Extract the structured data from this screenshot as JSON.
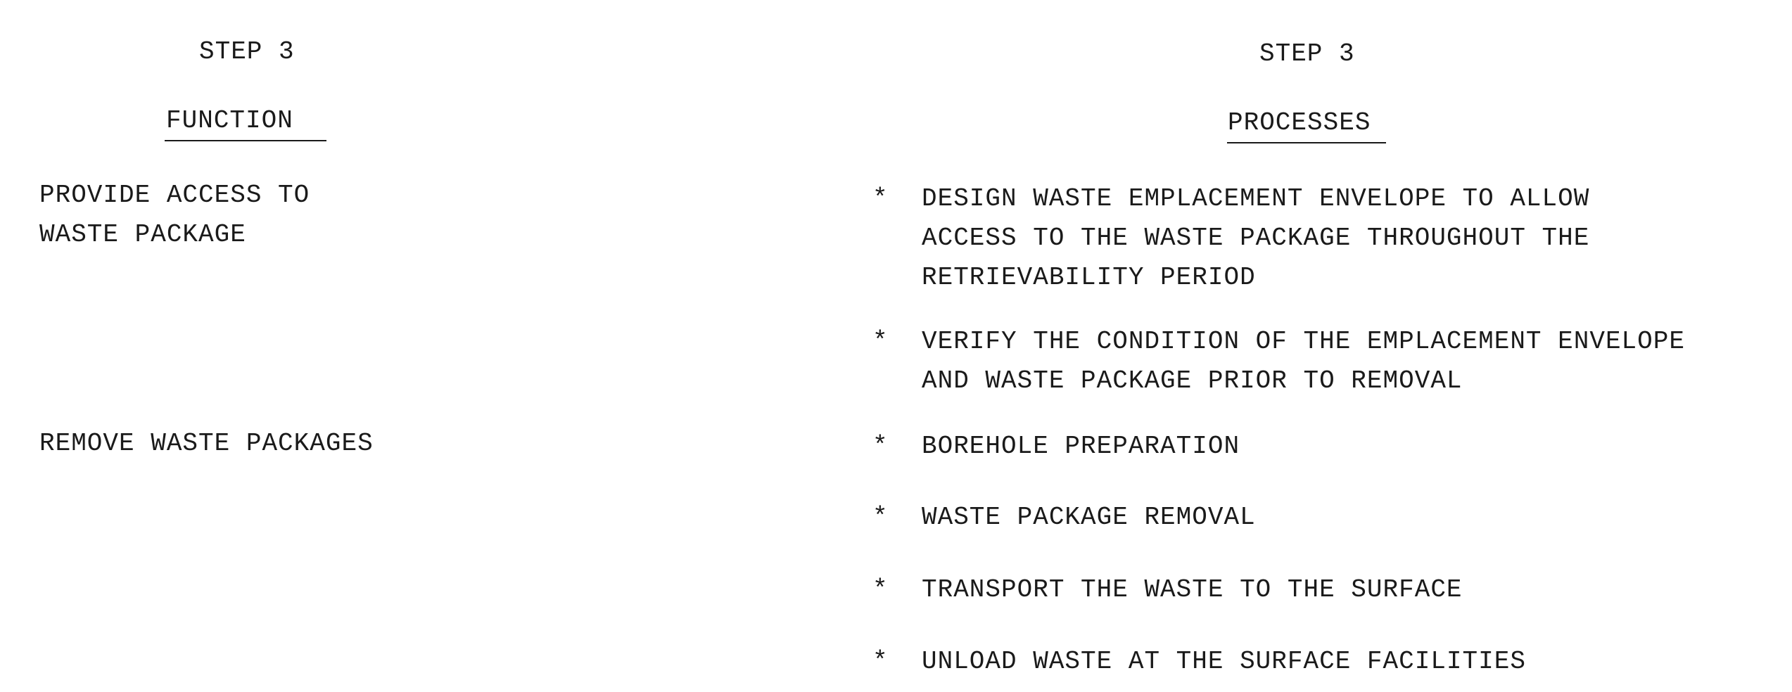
{
  "left": {
    "step": "STEP 3",
    "heading": "FUNCTION",
    "functions": [
      {
        "lines": [
          "PROVIDE ACCESS TO",
          "WASTE PACKAGE"
        ]
      },
      {
        "lines": [
          "REMOVE WASTE PACKAGES"
        ]
      }
    ]
  },
  "right": {
    "step": "STEP 3",
    "heading": "PROCESSES",
    "bullet": "*",
    "processes": [
      {
        "lines": [
          "DESIGN WASTE EMPLACEMENT ENVELOPE TO ALLOW",
          "ACCESS TO THE WASTE PACKAGE THROUGHOUT THE",
          "RETRIEVABILITY PERIOD"
        ]
      },
      {
        "lines": [
          "VERIFY THE CONDITION OF THE EMPLACEMENT ENVELOPE",
          "AND WASTE PACKAGE PRIOR TO REMOVAL"
        ]
      },
      {
        "lines": [
          "BOREHOLE PREPARATION"
        ]
      },
      {
        "lines": [
          "WASTE PACKAGE REMOVAL"
        ]
      },
      {
        "lines": [
          "TRANSPORT THE WASTE TO THE SURFACE"
        ]
      },
      {
        "lines": [
          "UNLOAD WASTE AT THE SURFACE FACILITIES"
        ]
      }
    ]
  }
}
